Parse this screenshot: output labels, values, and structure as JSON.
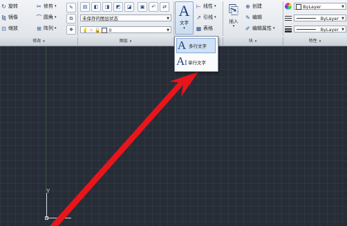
{
  "ribbon": {
    "modify": {
      "rotate": "旋转",
      "trim": "修剪",
      "mirror": "镜像",
      "fillet": "圆角",
      "scale": "缩放",
      "array": "阵列"
    },
    "layers": {
      "state_combo": "未保存的图层状态",
      "layer_combo": "0"
    },
    "annotation": {
      "text_label": "文字",
      "linear": "线性",
      "leader": "引线",
      "table": "表格"
    },
    "block": {
      "insert": "插入",
      "create": "创建",
      "edit": "编辑",
      "edit_attributes": "编辑属性"
    },
    "properties": {
      "color": "ByLayer",
      "linetype": "ByLayer",
      "lineweight": "ByLayer"
    }
  },
  "panel_titles": {
    "modify": "修改",
    "layers": "图层",
    "block": "块",
    "properties": "特性"
  },
  "dropdown": {
    "items": [
      {
        "label": "多行文字"
      },
      {
        "label": "单行文字"
      }
    ]
  },
  "canvas": {
    "ucs_y_label": "Y"
  },
  "colors": {
    "canvas_bg": "#272d37",
    "arrow": "#e8151b",
    "ribbon_bg": "#e6e9ee"
  },
  "icons": [
    "rotate-icon",
    "trim-icon",
    "mirror-icon",
    "fillet-icon",
    "scale-icon",
    "array-icon",
    "text-icon",
    "multiline-text-icon",
    "singleline-text-icon",
    "insert-block-icon",
    "color-wheel-icon"
  ]
}
